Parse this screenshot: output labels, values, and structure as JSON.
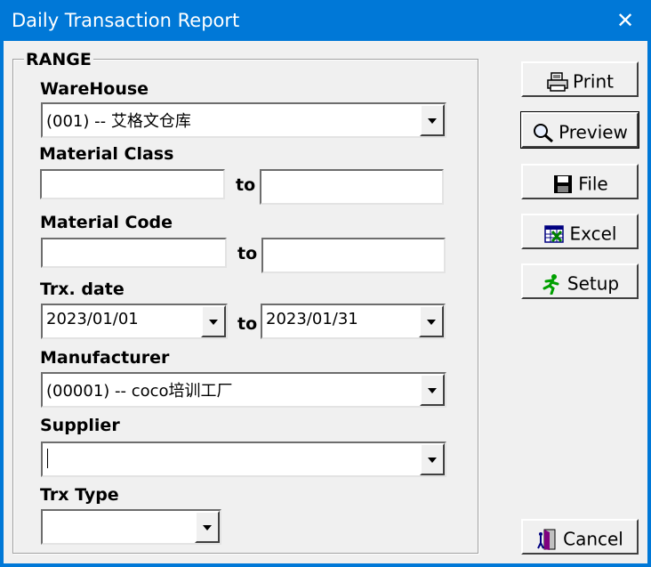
{
  "window": {
    "title": "Daily Transaction Report",
    "close_glyph": "✕"
  },
  "range": {
    "group_label": "RANGE",
    "warehouse": {
      "label": "WareHouse",
      "value": "(001) -- 艾格文仓库"
    },
    "material_class": {
      "label": "Material Class",
      "from": "",
      "to_label": "to",
      "to": ""
    },
    "material_code": {
      "label": "Material Code",
      "from": "",
      "to_label": "to",
      "to": ""
    },
    "trx_date": {
      "label": "Trx. date",
      "from": "2023/01/01",
      "to_label": "to",
      "to": "2023/01/31"
    },
    "manufacturer": {
      "label": "Manufacturer",
      "value": "(00001) -- coco培训工厂"
    },
    "supplier": {
      "label": "Supplier",
      "value": ""
    },
    "trx_type": {
      "label": "Trx Type",
      "value": ""
    }
  },
  "buttons": {
    "print": {
      "label": "Print",
      "icon": "printer-icon"
    },
    "preview": {
      "label": "Preview",
      "icon": "magnifier-icon"
    },
    "file": {
      "label": "File",
      "icon": "floppy-disk-icon"
    },
    "excel": {
      "label": "Excel",
      "icon": "excel-icon"
    },
    "setup": {
      "label": "Setup",
      "icon": "running-man-icon"
    },
    "cancel": {
      "label": "Cancel",
      "icon": "door-exit-icon"
    }
  },
  "colors": {
    "titlebar": "#0078d7",
    "face": "#f0f0f0"
  }
}
